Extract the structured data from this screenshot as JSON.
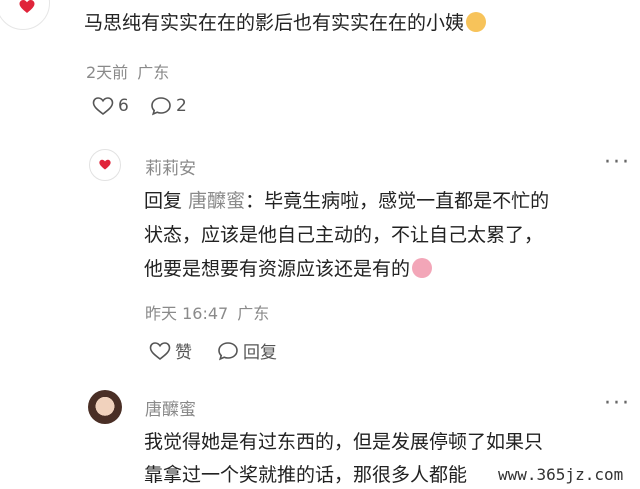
{
  "comment_main": {
    "text": "马思纯有实实在在的影后也有实实在在的小姨",
    "time": "2天前",
    "location": "广东",
    "likes": "6",
    "replies": "2"
  },
  "reply1": {
    "author": "莉莉安",
    "reply_prefix": "回复",
    "reply_to": "唐醾蜜",
    "colon": "：",
    "lines": [
      "毕竟生病啦，感觉一直都是不忙的",
      "状态，应该是他自己主动的，不让自己太累了，",
      "他要是想要有资源应该还是有的"
    ],
    "time": "昨天 16:47",
    "location": "广东",
    "like_label": "赞",
    "reply_label": "回复"
  },
  "reply2": {
    "author": "唐醾蜜",
    "lines": [
      "我觉得她是有过东西的，但是发展停顿了如果只",
      "靠拿过一个奖就推的话，那很多人都能"
    ]
  },
  "more_label": "···",
  "watermark": "www.365jz.com",
  "colors": {
    "heart": "#e0243a",
    "muted": "#8a8a8a"
  }
}
